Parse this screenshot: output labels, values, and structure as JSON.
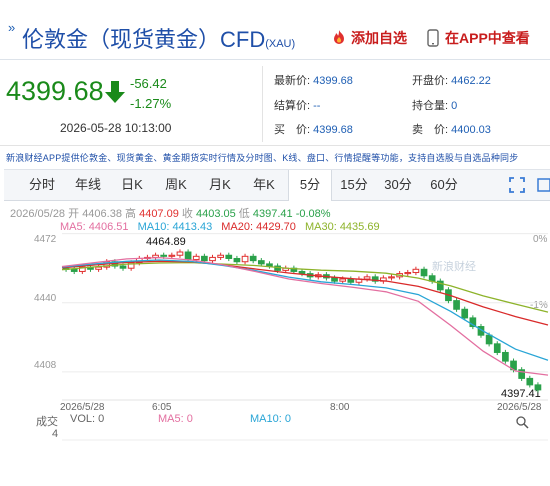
{
  "header": {
    "arrows": "»",
    "title": "伦敦金（现货黄金）CFD",
    "title_suffix": "(XAU)",
    "add_favorite": "添加自选",
    "open_app": "在APP中查看"
  },
  "quote": {
    "price": "4399.68",
    "change": "-56.42",
    "change_pct": "-1.27%",
    "datetime": "2026-05-28 10:13:00",
    "fields": [
      {
        "k": "最新价:",
        "v": "4399.68"
      },
      {
        "k": "开盘价:",
        "v": "4462.22"
      },
      {
        "k": "结算价:",
        "v": "--"
      },
      {
        "k": "持仓量:",
        "v": "0"
      },
      {
        "k": "买　价:",
        "v": "4399.68"
      },
      {
        "k": "卖　价:",
        "v": "4400.03"
      }
    ]
  },
  "notice": "新浪财经APP提供伦敦金、现货黄金、黄金期货实时行情及分时图、K线、盘口、行情提醒等功能，支持自选股与自选品种同步",
  "tabs": [
    "分时",
    "年线",
    "日K",
    "周K",
    "月K",
    "年K",
    "5分",
    "15分",
    "30分",
    "60分"
  ],
  "active_tab": "5分",
  "ohlc": {
    "date": "2026/05/28",
    "open_label": "开",
    "open": "4406.38",
    "high_label": "高",
    "high": "4407.09",
    "close_label": "收",
    "close": "4403.05",
    "low_label": "低",
    "low": "4397.41",
    "chg": "-0.08%"
  },
  "ma": [
    {
      "label": "MA5:",
      "value": "4406.51",
      "color": "#e36fa0"
    },
    {
      "label": "MA10:",
      "value": "4413.43",
      "color": "#29a5d6"
    },
    {
      "label": "MA20:",
      "value": "4429.70",
      "color": "#d92a2a"
    },
    {
      "label": "MA30:",
      "value": "4435.69",
      "color": "#8db32a"
    }
  ],
  "colors": {
    "up": "#e0302f",
    "down": "#2aa14a",
    "ma5": "#e36fa0",
    "ma10": "#29a5d6",
    "ma20": "#d92a2a",
    "ma30": "#8db32a"
  },
  "chart": {
    "ytick_labels": [
      "4472",
      "4440",
      "4408"
    ],
    "right_pct": [
      "0%",
      "-1%"
    ],
    "high_mark": "4464.89",
    "low_mark": "4397.41",
    "x_labels": [
      "2026/5/28",
      "6:05",
      "8:00",
      "2026/5/28"
    ],
    "watermark": "新浪财经"
  },
  "volume": {
    "title": "成交",
    "title2": "4",
    "vol": "VOL: 0",
    "ma5": "MA5: 0",
    "ma10": "MA10: 0"
  },
  "chart_data": {
    "type": "candlestick",
    "interval": "5分",
    "ylim": [
      4395,
      4476
    ],
    "yticks": [
      4408,
      4440,
      4472
    ],
    "candles_close": [
      4455.5,
      4454.5,
      4456.5,
      4455.5,
      4456.5,
      4459,
      4457,
      4456,
      4458.5,
      4460.5,
      4461,
      4462,
      4461.5,
      4462,
      4463.5,
      4460,
      4461.5,
      4459.5,
      4461,
      4462,
      4460.5,
      4459,
      4461.5,
      4459.5,
      4458,
      4457,
      4455,
      4456,
      4454.5,
      4453.5,
      4452,
      4453,
      4451.5,
      4450,
      4451,
      4449.5,
      4451,
      4452,
      4450,
      4451.5,
      4452,
      4453.5,
      4454,
      4455.5,
      4452.5,
      4450,
      4446,
      4441,
      4437,
      4433,
      4429,
      4425,
      4421,
      4417,
      4413,
      4409,
      4405,
      4402,
      4399.68
    ],
    "ma5": [
      4456.8,
      4458.6,
      4460.3,
      4460.9,
      4459.8,
      4457.5,
      4454.4,
      4451.0,
      4448.9,
      4447.1,
      4445.1,
      4440.7,
      4429.5,
      4417.6,
      4408.4,
      4406.51
    ],
    "ma10": [
      4456.5,
      4458.0,
      4459.2,
      4459.8,
      4459.1,
      4457.2,
      4454.8,
      4451.9,
      4449.7,
      4448.4,
      4446.9,
      4443.8,
      4436.0,
      4426.9,
      4418.5,
      4413.43
    ],
    "ma20": [
      4456.2,
      4457.5,
      4458.7,
      4459.2,
      4458.9,
      4457.5,
      4455.6,
      4453.8,
      4452.3,
      4451.1,
      4450.1,
      4447.6,
      4443.3,
      4438.1,
      4433.6,
      4429.7
    ],
    "ma30": [
      4455.3,
      4456.6,
      4457.9,
      4458.4,
      4458.6,
      4457.9,
      4457.2,
      4455.9,
      4455.1,
      4454.6,
      4453.7,
      4451.4,
      4447.8,
      4443.2,
      4439.4,
      4435.69
    ]
  }
}
